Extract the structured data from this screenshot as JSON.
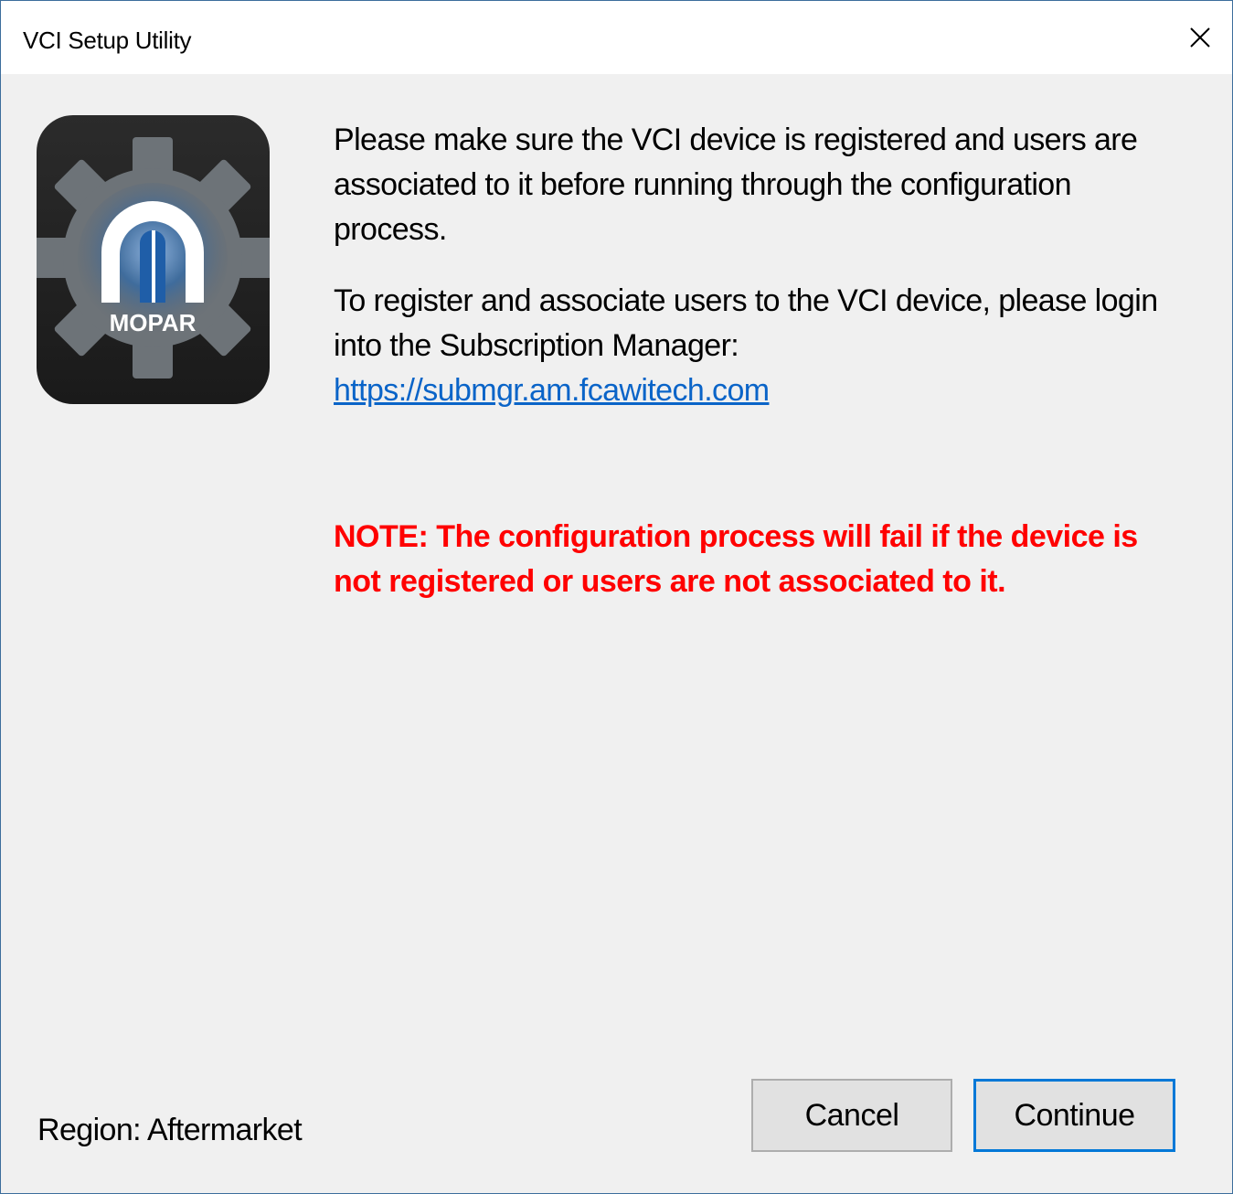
{
  "window": {
    "title": "VCI Setup Utility"
  },
  "logo": {
    "brand_text": "MOPAR"
  },
  "message": {
    "paragraph1": "Please make sure the VCI device is registered and users are associated to it before running through the configuration process.",
    "paragraph2": "To register and associate users to the VCI device, please login into the Subscription Manager:",
    "link": "https://submgr.am.fcawitech.com",
    "note": "NOTE: The configuration process will fail if the device is not registered or users are not associated to it."
  },
  "footer": {
    "region": "Region: Aftermarket",
    "cancel_label": "Cancel",
    "continue_label": "Continue"
  },
  "colors": {
    "note": "#ff0000",
    "link": "#0a64c8",
    "focus_border": "#0078d7"
  }
}
